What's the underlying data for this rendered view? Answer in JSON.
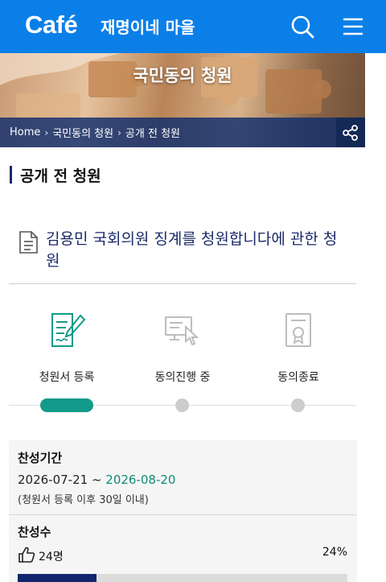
{
  "header": {
    "logo": "Café",
    "cafe_name": "재명이네 마을",
    "icons": [
      "search-icon",
      "hamburger-menu-icon"
    ],
    "brand_color": "#0b7fe8"
  },
  "banner": {
    "title": "국민동의 청원",
    "breadcrumb": [
      "Home",
      "국민동의 청원",
      "공개 전 청원"
    ],
    "share_icon": "share-icon"
  },
  "section": {
    "title": "공개 전 청원"
  },
  "petition": {
    "title": "김용민 국회의원 징계를 청원합니다에 관한 청원",
    "icon": "document-icon"
  },
  "steps": [
    {
      "label": "청원서 등록",
      "icon": "document-edit-icon",
      "active": true
    },
    {
      "label": "동의진행 중",
      "icon": "computer-click-icon",
      "active": false
    },
    {
      "label": "동의종료",
      "icon": "certificate-icon",
      "active": false
    }
  ],
  "accent_color": "#129b8a",
  "agree_period": {
    "label": "찬성기간",
    "start": "2026-07-21",
    "separator": " ~ ",
    "end": "2026-08-20",
    "note": "(청원서 등록 이후 30일 이내)"
  },
  "agree_count": {
    "label": "찬성수",
    "count": "24명",
    "percent_text": "24%",
    "progress": 0.24,
    "icon": "thumbs-up-icon"
  }
}
